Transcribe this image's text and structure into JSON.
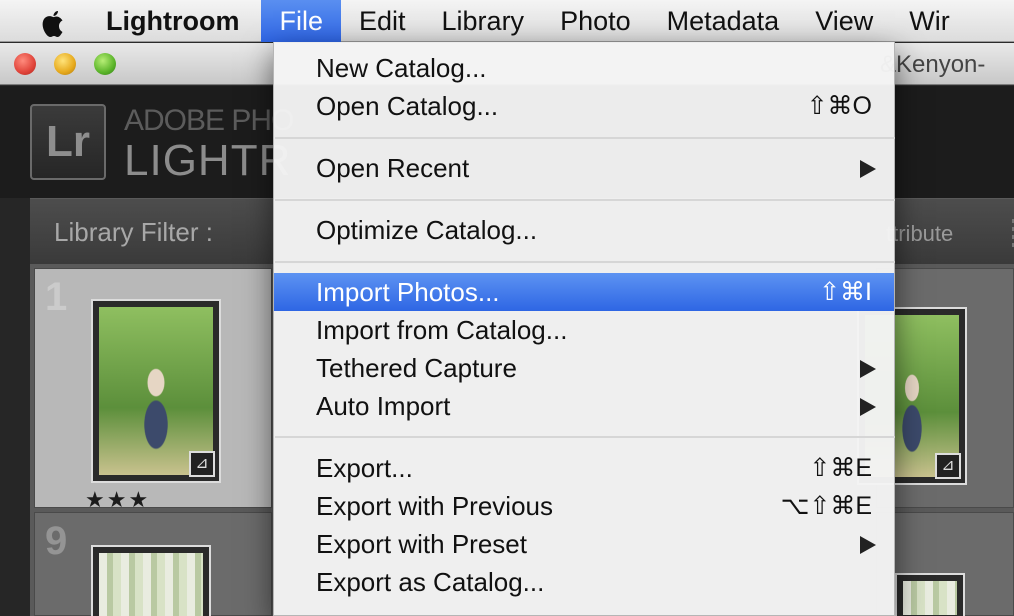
{
  "menubar": {
    "app_name": "Lightroom",
    "menus": [
      "File",
      "Edit",
      "Library",
      "Photo",
      "Metadata",
      "View",
      "Wir"
    ],
    "active_menu": "File"
  },
  "window": {
    "title_fragment": "&Kenyon-"
  },
  "lightroom": {
    "logo": "Lr",
    "adobe_text": "ADOBE PHO",
    "product_text": "LIGHTR"
  },
  "library_filter": {
    "label": "Library Filter :",
    "attribute_label": "ttribute"
  },
  "grid": {
    "cell_numbers": [
      "1",
      "9"
    ],
    "rating": "★★★"
  },
  "file_menu": {
    "items": [
      {
        "label": "New Catalog...",
        "shortcut": ""
      },
      {
        "label": "Open Catalog...",
        "shortcut": "⇧⌘O"
      },
      {
        "label": "Open Recent",
        "submenu": true
      },
      {
        "label": "Optimize Catalog...",
        "shortcut": ""
      },
      {
        "label": "Import Photos...",
        "shortcut": "⇧⌘I",
        "highlighted": true
      },
      {
        "label": "Import from Catalog...",
        "shortcut": ""
      },
      {
        "label": "Tethered Capture",
        "submenu": true
      },
      {
        "label": "Auto Import",
        "submenu": true
      },
      {
        "label": "Export...",
        "shortcut": "⇧⌘E"
      },
      {
        "label": "Export with Previous",
        "shortcut": "⌥⇧⌘E"
      },
      {
        "label": "Export with Preset",
        "submenu": true
      },
      {
        "label": "Export as Catalog...",
        "shortcut": ""
      }
    ]
  },
  "colors": {
    "menu_highlight": "#2e66e4",
    "menubar_bg": "#e4e4e4",
    "lightroom_bg": "#1c1c1c"
  }
}
